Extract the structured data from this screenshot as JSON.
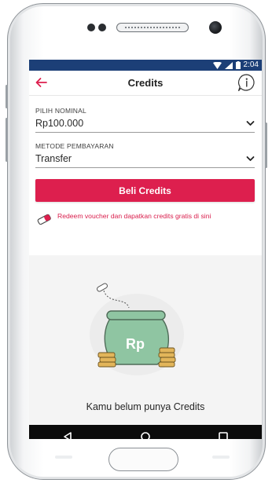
{
  "status_bar": {
    "time": "2:04"
  },
  "app_bar": {
    "title": "Credits"
  },
  "nominal": {
    "label": "PILIH NOMINAL",
    "value": "Rp100.000"
  },
  "payment": {
    "label": "METODE PEMBAYARAN",
    "value": "Transfer"
  },
  "buy_button": {
    "label": "Beli Credits"
  },
  "redeem": {
    "text": "Redeem voucher dan dapatkan credits gratis di sini"
  },
  "illustration": {
    "pot_label": "Rp"
  },
  "empty_state": {
    "message": "Kamu belum punya Credits"
  },
  "colors": {
    "accent": "#dd1f4e",
    "status_bar": "#1c3f77",
    "pot_green": "#8fc5a2",
    "coin_gold": "#e2b55a"
  },
  "icons": {
    "back": "arrow-left-icon",
    "info": "info-icon",
    "dropdown": "chevron-down-icon",
    "redeem": "eraser-icon",
    "nav_back": "triangle-back-icon",
    "nav_home": "circle-home-icon",
    "nav_recents": "square-recents-icon"
  }
}
